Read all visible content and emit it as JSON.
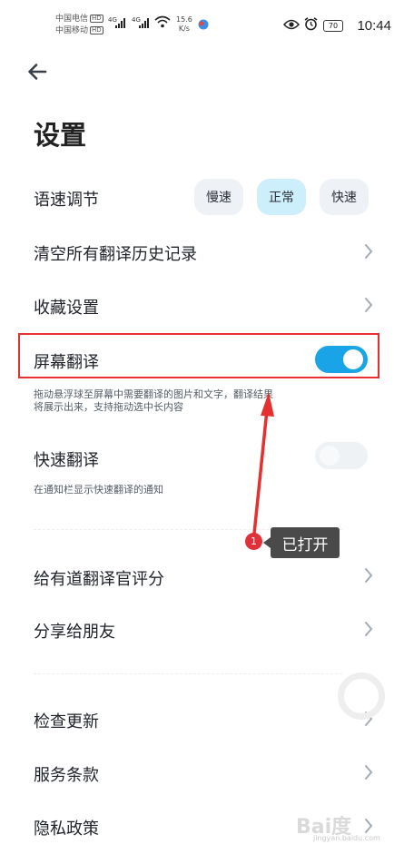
{
  "status_bar": {
    "carrier_1": "中国电信",
    "carrier_2": "中国移动",
    "hd": "HD",
    "network": "4G",
    "net_speed_value": "15.6",
    "net_speed_unit": "K/s",
    "battery": "70",
    "time": "10:44"
  },
  "page": {
    "title": "设置"
  },
  "speech_speed": {
    "label": "语速调节",
    "options": [
      "慢速",
      "正常",
      "快速"
    ],
    "selected": "正常"
  },
  "menu": {
    "clear_history": "清空所有翻译历史记录",
    "favorites": "收藏设置",
    "screen_translate": {
      "label": "屏幕翻译",
      "enabled": true,
      "description_line1": "拖动悬浮球至屏幕中需要翻译的图片和文字，翻译结果",
      "description_line2": "将展示出来，支持拖动选中长内容"
    },
    "quick_translate": {
      "label": "快速翻译",
      "enabled": false,
      "description": "在通知栏显示快速翻译的通知"
    },
    "rate_app": "给有道翻译官评分",
    "share": "分享给朋友",
    "check_update": "检查更新",
    "terms": "服务条款",
    "privacy": "隐私政策"
  },
  "annotation": {
    "step": "1",
    "text": "已打开",
    "highlight_color": "#e53030"
  },
  "watermark": {
    "text": "Bai度",
    "sub": "jingyan.baidu.com"
  },
  "colors": {
    "accent": "#1aa4e8",
    "speed_active_bg": "#cdeefb"
  }
}
